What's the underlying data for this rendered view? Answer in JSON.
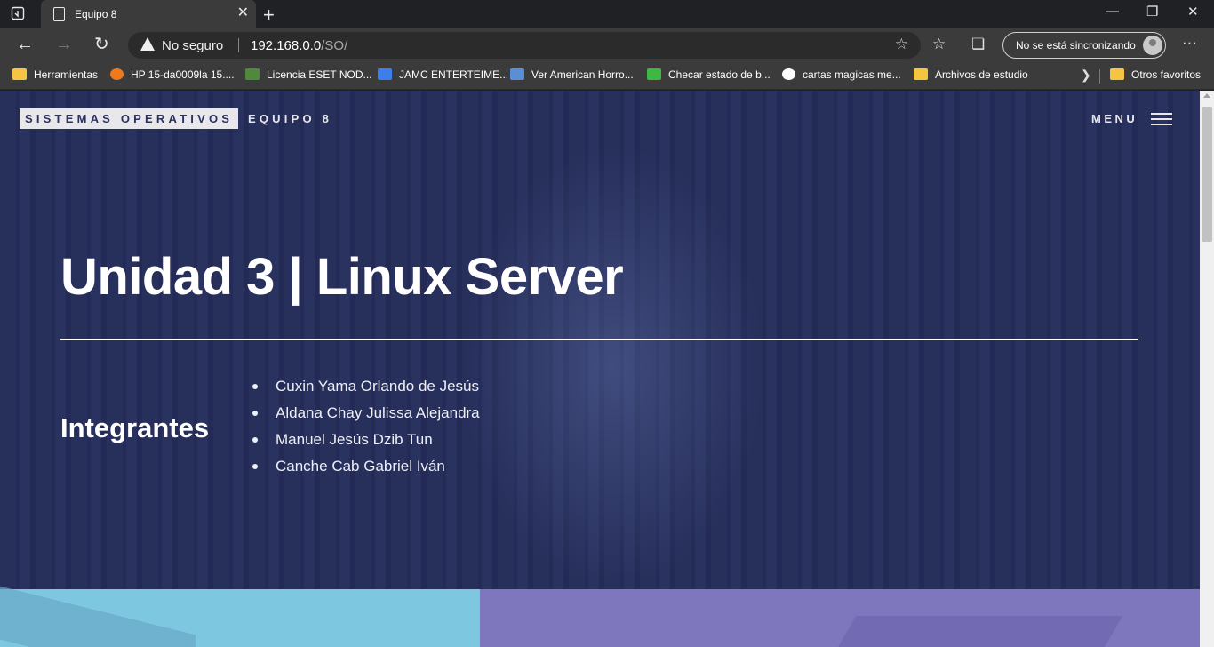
{
  "browser": {
    "tab_title": "Equipo 8",
    "security_label": "No seguro",
    "url_host": "192.168.0.0",
    "url_path": "/SO/",
    "sync_label": "No se está sincronizando",
    "bookmarks": [
      {
        "label": "Herramientas",
        "icon": "folder-icon"
      },
      {
        "label": "HP 15-da0009la 15....",
        "icon": "hp-icon"
      },
      {
        "label": "Licencia ESET NOD...",
        "icon": "eset-icon"
      },
      {
        "label": "JAMC ENTERTEIME...",
        "icon": "cloud-icon"
      },
      {
        "label": "Ver American Horro...",
        "icon": "video-icon"
      },
      {
        "label": "Checar estado de b...",
        "icon": "recycle-icon"
      },
      {
        "label": "cartas magicas me...",
        "icon": "google-icon"
      },
      {
        "label": "Archivos de estudio",
        "icon": "folder-icon"
      }
    ],
    "other_bookmarks": "Otros favoritos"
  },
  "site": {
    "brand": "SISTEMAS OPERATIVOS",
    "team": "EQUIPO 8",
    "menu_label": "MENU",
    "heading": "Unidad 3 | Linux Server",
    "members_label": "Integrantes",
    "members": [
      "Cuxin Yama Orlando de Jesús",
      "Aldana Chay Julissa Alejandra",
      "Manuel Jesús Dzib Tun",
      "Canche Cab Gabriel Iván"
    ]
  },
  "colors": {
    "hero_overlay": "#242a54",
    "panel_left": "#7ec7e0",
    "panel_right": "#7f77bd"
  }
}
